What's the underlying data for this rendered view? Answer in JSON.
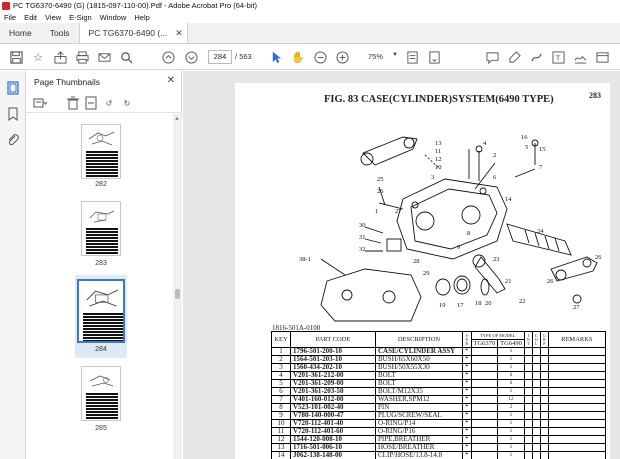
{
  "window": {
    "title": "PC TG6370-6490 (G) (1815-097-110-00).Pdf - Adobe Acrobat Pro (64-bit)"
  },
  "menu": [
    "File",
    "Edit",
    "View",
    "E-Sign",
    "Window",
    "Help"
  ],
  "tabs": {
    "home": "Home",
    "tools": "Tools",
    "document": "PC TG6370-6490 (..."
  },
  "toolbar": {
    "current_page": "284",
    "page_separator": "/",
    "total_pages": "563",
    "zoom": "75%"
  },
  "thumbnails_panel": {
    "title": "Page Thumbnails",
    "pages": [
      {
        "label": "282",
        "selected": false
      },
      {
        "label": "283",
        "selected": false
      },
      {
        "label": "284",
        "selected": true
      },
      {
        "label": "285",
        "selected": false
      }
    ]
  },
  "document_page": {
    "page_number": "283",
    "title": "FIG. 83  CASE(CYLINDER)SYSTEM(6490 TYPE)",
    "doc_ref": "1816-501A-0100",
    "callouts": [
      "1",
      "2",
      "3",
      "4",
      "5",
      "6",
      "7",
      "8",
      "9",
      "10",
      "11",
      "12",
      "13",
      "14",
      "15",
      "16",
      "17",
      "18",
      "19",
      "20",
      "21",
      "22",
      "23",
      "24",
      "25",
      "26",
      "27",
      "28",
      "29",
      "30",
      "31",
      "32",
      "38-1"
    ],
    "table": {
      "headers": {
        "key": "KEY",
        "part_code": "PART CODE",
        "description": "DESCRIPTION",
        "s": "S E R",
        "type_of_model": "TYPE OF MODEL",
        "model_a": "TG6370",
        "model_b": "TG6490",
        "i": "I N T",
        "c": "C O L",
        "g": "G R P",
        "remarks": "REMARKS"
      },
      "rows": [
        {
          "key": "1",
          "code": "1796-501-200-10",
          "desc": "CASE/CYLINDER  ASSY",
          "s": "*",
          "qty": "1"
        },
        {
          "key": "2",
          "code": "1564-501-203-10",
          "desc": "BUSH/65X60X50",
          "s": "*",
          "qty": "1"
        },
        {
          "key": "3",
          "code": "1560-434-202-10",
          "desc": "BUSH/50X55X30",
          "s": "*",
          "qty": "1"
        },
        {
          "key": "4",
          "code": "V201-361-212-00",
          "desc": "BOLT",
          "s": "*",
          "qty": "6"
        },
        {
          "key": "5",
          "code": "V201-361-209-00",
          "desc": "BOLT",
          "s": "*",
          "qty": "6"
        },
        {
          "key": "6",
          "code": "V201-361-203-50",
          "desc": "BOLT/M12X35",
          "s": "*",
          "qty": "1"
        },
        {
          "key": "7",
          "code": "V401-160-012-00",
          "desc": "WASHER,SPM12",
          "s": "*",
          "qty": "12"
        },
        {
          "key": "8",
          "code": "V523-101-002-40",
          "desc": "PIN",
          "s": "*",
          "qty": "2"
        },
        {
          "key": "9",
          "code": "V780-140-000-47",
          "desc": "PLUG/SCREW/SEAL",
          "s": "*",
          "qty": "1"
        },
        {
          "key": "10",
          "code": "V720-112-401-40",
          "desc": "O-RING/P14",
          "s": "*",
          "qty": "1"
        },
        {
          "key": "11",
          "code": "V720-112-401-60",
          "desc": "O-RING/P16",
          "s": "*",
          "qty": "1"
        },
        {
          "key": "12",
          "code": "1544-120-008-10",
          "desc": "PIPE,BREATHER",
          "s": "*",
          "qty": "1"
        },
        {
          "key": "13",
          "code": "1716-501-006-10",
          "desc": "HOSE/BREATHER",
          "s": "*",
          "qty": "1"
        },
        {
          "key": "14",
          "code": "J062-138-148-00",
          "desc": "CLIP/HOSE/13.8-14.8",
          "s": "*",
          "qty": "1"
        }
      ]
    }
  }
}
